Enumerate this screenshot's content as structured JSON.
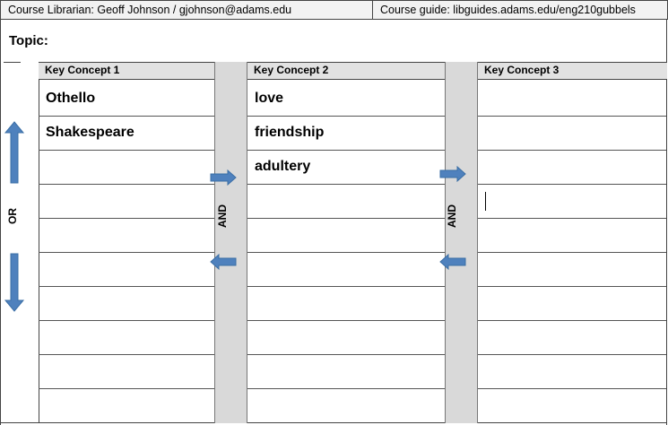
{
  "header": {
    "librarian": "Course Librarian:  Geoff Johnson / gjohnson@adams.edu",
    "guide": "Course guide: libguides.adams.edu/eng210gubbels"
  },
  "topic": {
    "label": "Topic:",
    "value": ""
  },
  "operators": {
    "or": "OR",
    "and_1": "AND",
    "and_2": "AND"
  },
  "columns": [
    {
      "title": "Key Concept 1",
      "terms": [
        "Othello",
        "Shakespeare",
        "",
        "",
        "",
        "",
        "",
        "",
        "",
        ""
      ]
    },
    {
      "title": "Key Concept 2",
      "terms": [
        "love",
        "friendship",
        "adultery",
        "",
        "",
        "",
        "",
        "",
        "",
        ""
      ]
    },
    {
      "title": "Key Concept 3",
      "terms": [
        "",
        "",
        "",
        "",
        "",
        "",
        "",
        "",
        "",
        ""
      ]
    }
  ],
  "colors": {
    "arrow": "#4f81bd",
    "band": "#d9d9d9",
    "header_fill": "#e2e2e2"
  },
  "icons": [
    "arrow-up-icon",
    "arrow-down-icon",
    "arrow-right-icon",
    "arrow-left-icon"
  ]
}
